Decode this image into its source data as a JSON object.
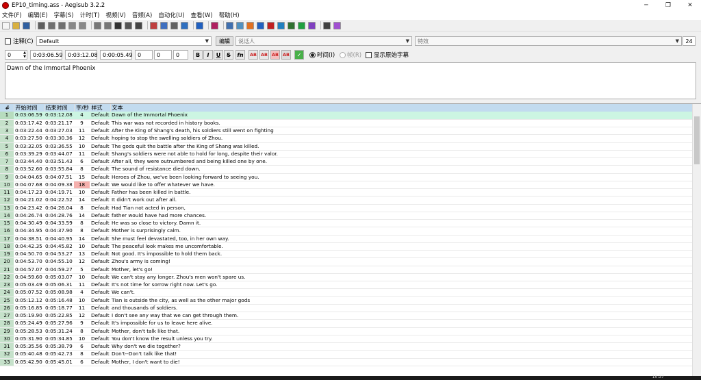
{
  "window": {
    "title": "EP10_timing.ass - Aegisub 3.2.2",
    "minimize": "─",
    "maximize": "❐",
    "close": "✕"
  },
  "menu": [
    "文件(F)",
    "编辑(E)",
    "字幕(S)",
    "计时(T)",
    "视频(V)",
    "音频(A)",
    "自动化(U)",
    "查看(W)",
    "帮助(H)"
  ],
  "toolbar_icons": [
    {
      "name": "new-file-icon",
      "color": "#f5f5f5"
    },
    {
      "name": "open-file-icon",
      "color": "#d8b040"
    },
    {
      "name": "save-icon",
      "color": "#3060a0"
    },
    "sep",
    {
      "name": "jump-icon",
      "color": "#606060"
    },
    {
      "name": "find-icon",
      "color": "#707070"
    },
    {
      "name": "replace-icon",
      "color": "#707070"
    },
    {
      "name": "copy-icon",
      "color": "#888"
    },
    {
      "name": "paste-icon",
      "color": "#888"
    },
    "sep",
    {
      "name": "properties-icon",
      "color": "#777"
    },
    {
      "name": "styles-icon",
      "color": "#777"
    },
    {
      "name": "attachments-icon",
      "color": "#333"
    },
    {
      "name": "resample-icon",
      "color": "#555"
    },
    {
      "name": "fonts-icon",
      "color": "#444"
    },
    "sep",
    {
      "name": "spellcheck-icon",
      "color": "#c04040"
    },
    {
      "name": "translate-icon",
      "color": "#4070c0"
    },
    {
      "name": "tag-icon",
      "color": "#606060"
    },
    {
      "name": "style-assist-icon",
      "color": "#3070c0"
    },
    "sep",
    {
      "name": "automation-icon",
      "color": "#2060c0"
    },
    "sep",
    {
      "name": "aegisub-logo-icon",
      "color": "#b02060"
    },
    "sep",
    {
      "name": "shift-times-icon",
      "color": "#4070b0"
    },
    {
      "name": "timing-postprocessor-icon",
      "color": "#5090c0"
    },
    {
      "name": "kanji-timer-icon",
      "color": "#e07020"
    },
    {
      "name": "snap-start-icon",
      "color": "#2060c0"
    },
    {
      "name": "snap-end-icon",
      "color": "#c02020"
    },
    {
      "name": "clock-icon",
      "color": "#2080c0"
    },
    {
      "name": "video-frame-icon",
      "color": "#307030"
    },
    {
      "name": "check-tool-icon",
      "color": "#20a040"
    },
    {
      "name": "keyframe-icon",
      "color": "#8040c0"
    },
    "sep",
    {
      "name": "options-icon",
      "color": "#404040"
    },
    {
      "name": "hotkeys-icon",
      "color": "#a050d0"
    }
  ],
  "edit": {
    "comment_label": "注释(C)",
    "style": "Default",
    "edit_button": "编辑",
    "actor_placeholder": "说话人",
    "effect_placeholder": "特效",
    "char_count": "24",
    "layer": "0",
    "start": "0:03:06.59",
    "end": "0:03:12.08",
    "duration": "0:00:05.49",
    "margin_l": "0",
    "margin_r": "0",
    "margin_v": "0",
    "bold": "B",
    "italic": "I",
    "underline": "U",
    "strike": "S",
    "font": "fn",
    "color1": "AB",
    "color2": "AB",
    "color3": "AB",
    "color4": "AB",
    "commit": "✓",
    "time_label": "时间(I)",
    "frame_label": "帧(R)",
    "show_original_label": "显示原始字幕",
    "text": "Dawn of the Immortal Phoenix"
  },
  "grid": {
    "headers": [
      "#",
      "开始时间",
      "结束时间",
      "字/秒",
      "样式",
      "文本"
    ],
    "rows": [
      [
        "1",
        "0:03:06.59",
        "0:03:12.08",
        "4",
        "Default",
        "Dawn of the Immortal Phoenix"
      ],
      [
        "2",
        "0:03:17.42",
        "0:03:21.17",
        "9",
        "Default",
        "This war was not recorded in history books."
      ],
      [
        "3",
        "0:03:22.44",
        "0:03:27.03",
        "11",
        "Default",
        "After the King of Shang's death, his soldiers still went on fighting"
      ],
      [
        "4",
        "0:03:27.50",
        "0:03:30.36",
        "12",
        "Default",
        "hoping to stop the swelling soldiers of Zhou."
      ],
      [
        "5",
        "0:03:32.05",
        "0:03:36.55",
        "10",
        "Default",
        "The gods quit the battle after the King of Shang was killed."
      ],
      [
        "6",
        "0:03:39.29",
        "0:03:44.07",
        "11",
        "Default",
        "Shang's soldiers were not able to hold for long, despite their valor."
      ],
      [
        "7",
        "0:03:44.40",
        "0:03:51.43",
        "6",
        "Default",
        "After all, they were outnumbered and being killed one by one."
      ],
      [
        "8",
        "0:03:52.60",
        "0:03:55.84",
        "8",
        "Default",
        "The sound of resistance died down."
      ],
      [
        "9",
        "0:04:04.65",
        "0:04:07.51",
        "15",
        "Default",
        "Heroes of Zhou, we've been looking forward to seeing you."
      ],
      [
        "10",
        "0:04:07.68",
        "0:04:09.38",
        "18",
        "Default",
        "We would like to offer whatever we have."
      ],
      [
        "11",
        "0:04:17.23",
        "0:04:19.71",
        "10",
        "Default",
        "Father has been killed in battle."
      ],
      [
        "12",
        "0:04:21.02",
        "0:04:22.52",
        "14",
        "Default",
        "It didn't work out after all."
      ],
      [
        "13",
        "0:04:23.42",
        "0:04:26.04",
        "8",
        "Default",
        "Had Tian not acted in person,"
      ],
      [
        "14",
        "0:04:26.74",
        "0:04:28.76",
        "14",
        "Default",
        "father would have had more chances."
      ],
      [
        "15",
        "0:04:30.49",
        "0:04:33.59",
        "8",
        "Default",
        "He was so close to victory. Damn it."
      ],
      [
        "16",
        "0:04:34.95",
        "0:04:37.90",
        "8",
        "Default",
        "Mother is surprisingly calm."
      ],
      [
        "17",
        "0:04:38.51",
        "0:04:40.95",
        "14",
        "Default",
        "She must feel devastated, too, in her own way."
      ],
      [
        "18",
        "0:04:42.35",
        "0:04:45.82",
        "10",
        "Default",
        "The peaceful look makes me uncomfortable."
      ],
      [
        "19",
        "0:04:50.70",
        "0:04:53.27",
        "13",
        "Default",
        "Not good. It's impossible to hold them back."
      ],
      [
        "20",
        "0:04:53.70",
        "0:04:55.10",
        "12",
        "Default",
        "Zhou's army is coming!"
      ],
      [
        "21",
        "0:04:57.07",
        "0:04:59.27",
        "5",
        "Default",
        "Mother, let's go!"
      ],
      [
        "22",
        "0:04:59.60",
        "0:05:03.07",
        "10",
        "Default",
        "We can't stay any longer. Zhou's men won't spare us."
      ],
      [
        "23",
        "0:05:03.49",
        "0:05:06.31",
        "11",
        "Default",
        "It's not time for sorrow right now. Let's go."
      ],
      [
        "24",
        "0:05:07.52",
        "0:05:08.98",
        "4",
        "Default",
        "We can't."
      ],
      [
        "25",
        "0:05:12.12",
        "0:05:16.48",
        "10",
        "Default",
        "Tian is outside the city, as well as the other major gods"
      ],
      [
        "26",
        "0:05:16.85",
        "0:05:18.77",
        "11",
        "Default",
        "and thousands of soldiers."
      ],
      [
        "27",
        "0:05:19.90",
        "0:05:22.85",
        "12",
        "Default",
        "I don't see any way that we can get through them."
      ],
      [
        "28",
        "0:05:24.49",
        "0:05:27.96",
        "9",
        "Default",
        "It's impossible for us to leave here alive."
      ],
      [
        "29",
        "0:05:28.53",
        "0:05:31.24",
        "8",
        "Default",
        "Mother, don't talk like that."
      ],
      [
        "30",
        "0:05:31.90",
        "0:05:34.85",
        "10",
        "Default",
        "You don't know the result unless you try."
      ],
      [
        "31",
        "0:05:35.56",
        "0:05:38.79",
        "6",
        "Default",
        "Why don't we die together?"
      ],
      [
        "32",
        "0:05:40.48",
        "0:05:42.73",
        "8",
        "Default",
        "Don't--Don't talk like that!"
      ],
      [
        "33",
        "0:05:42.90",
        "0:05:45.01",
        "6",
        "Default",
        "Mother, I don't want to die!"
      ]
    ]
  },
  "taskbar": {
    "clock": "10:37"
  }
}
